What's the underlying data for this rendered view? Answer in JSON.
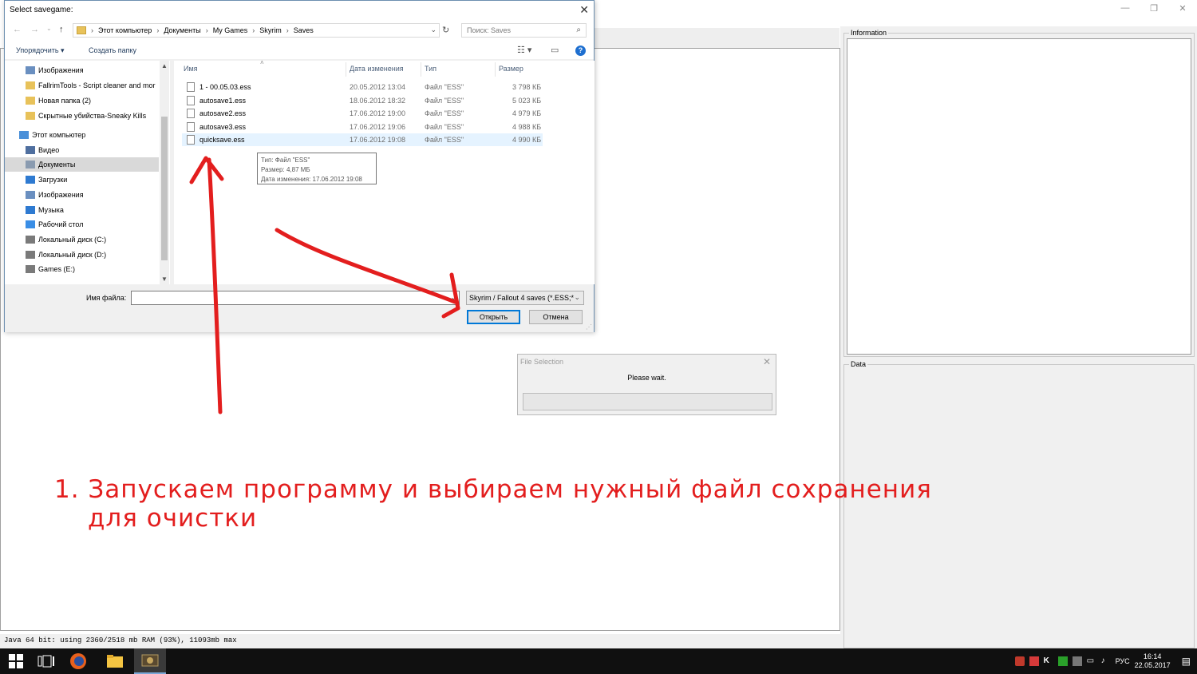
{
  "app": {
    "window_controls": [
      "—",
      "❐",
      "✕"
    ],
    "information_label": "Information",
    "data_label": "Data",
    "status_text": "Java 64 bit: using 2360/2518 mb RAM (93%), 11093mb max"
  },
  "dialog": {
    "title": "Select savegame:",
    "breadcrumb": [
      "Этот компьютер",
      "Документы",
      "My Games",
      "Skyrim",
      "Saves"
    ],
    "search_placeholder": "Поиск: Saves",
    "toolbar": {
      "organize": "Упорядочить ▾",
      "new_folder": "Создать папку"
    },
    "nav_items": [
      {
        "label": "Изображения",
        "icon": "pictures-icon",
        "color": "#6a8fc0"
      },
      {
        "label": "FallrimTools - Script cleaner and mor",
        "icon": "folder-icon",
        "color": "#e8c25a"
      },
      {
        "label": "Новая папка (2)",
        "icon": "folder-icon",
        "color": "#e8c25a"
      },
      {
        "label": "Скрытные убийства-Sneaky Kills",
        "icon": "folder-icon",
        "color": "#e8c25a"
      },
      {
        "label": "Этот компьютер",
        "icon": "computer-icon",
        "color": "#4a90d9"
      },
      {
        "label": "Видео",
        "icon": "video-icon",
        "color": "#4f6f9f"
      },
      {
        "label": "Документы",
        "icon": "documents-icon",
        "color": "#8a9bb0"
      },
      {
        "label": "Загрузки",
        "icon": "downloads-icon",
        "color": "#2e7ad1"
      },
      {
        "label": "Изображения",
        "icon": "pictures-icon",
        "color": "#6a8fc0"
      },
      {
        "label": "Музыка",
        "icon": "music-icon",
        "color": "#2e7ad1"
      },
      {
        "label": "Рабочий стол",
        "icon": "desktop-icon",
        "color": "#3a8ee6"
      },
      {
        "label": "Локальный диск (C:)",
        "icon": "drive-icon",
        "color": "#7a7a7a"
      },
      {
        "label": "Локальный диск (D:)",
        "icon": "drive-icon",
        "color": "#7a7a7a"
      },
      {
        "label": "Games (E:)",
        "icon": "drive-icon",
        "color": "#7a7a7a"
      }
    ],
    "columns": [
      "Имя",
      "Дата изменения",
      "Тип",
      "Размер"
    ],
    "files": [
      {
        "name": "1 -              00.05.03.ess",
        "date": "20.05.2012 13:04",
        "type": "Файл \"ESS\"",
        "size": "3 798 КБ"
      },
      {
        "name": "autosave1.ess",
        "date": "18.06.2012 18:32",
        "type": "Файл \"ESS\"",
        "size": "5 023 КБ"
      },
      {
        "name": "autosave2.ess",
        "date": "17.06.2012 19:00",
        "type": "Файл \"ESS\"",
        "size": "4 979 КБ"
      },
      {
        "name": "autosave3.ess",
        "date": "17.06.2012 19:06",
        "type": "Файл \"ESS\"",
        "size": "4 988 КБ"
      },
      {
        "name": "quicksave.ess",
        "date": "17.06.2012 19:08",
        "type": "Файл \"ESS\"",
        "size": "4 990 КБ"
      }
    ],
    "tooltip": [
      "Тип: Файл \"ESS\"",
      "Размер: 4,87 МБ",
      "Дата изменения: 17.06.2012 19:08"
    ],
    "filename_label": "Имя файла:",
    "filename_value": "",
    "filter": "Skyrim / Fallout 4 saves (*.ESS;*",
    "open_label": "Открыть",
    "cancel_label": "Отмена"
  },
  "progress_dialog": {
    "title": "File Selection",
    "message": "Please wait.",
    "progress": 0
  },
  "annotation": {
    "line1": "1. Запускаем программу и выбираем нужный файл сохранения",
    "line2": "для очистки",
    "color": "#e31e1e"
  },
  "taskbar": {
    "lang": "РУС",
    "time": "16:14",
    "date": "22.05.2017"
  }
}
